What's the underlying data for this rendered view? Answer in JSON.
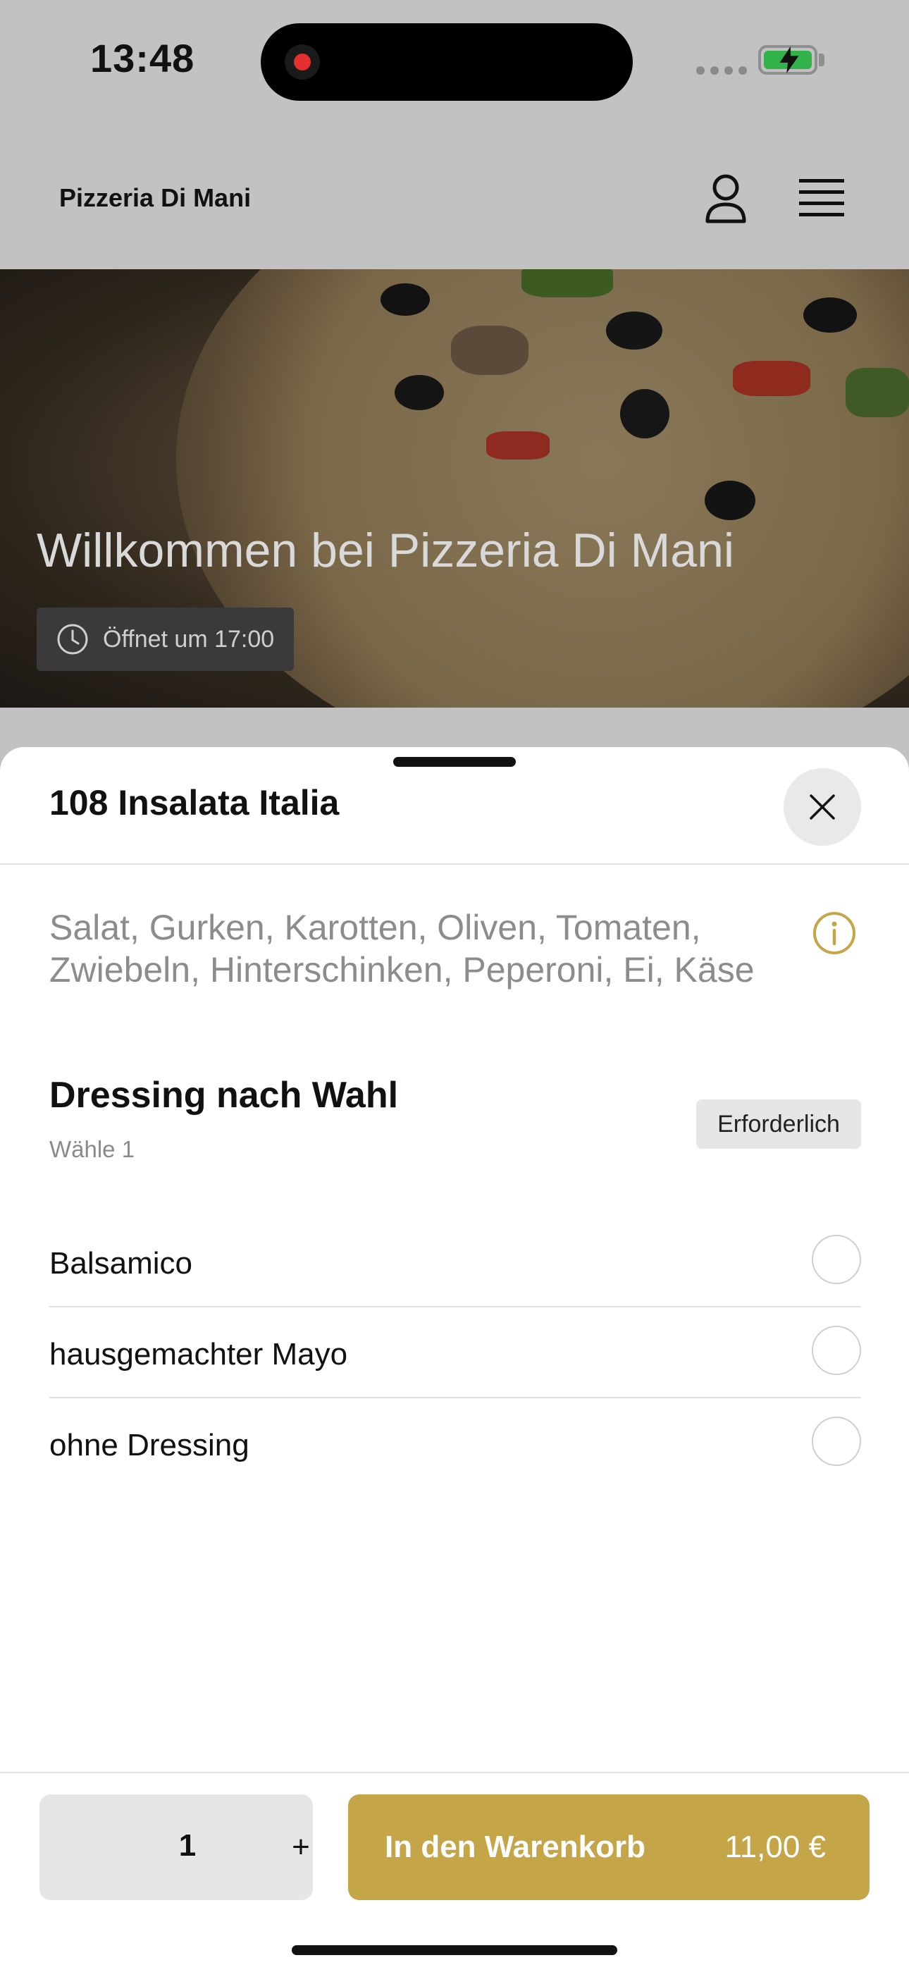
{
  "status_bar": {
    "time": "13:48"
  },
  "header": {
    "brand": "Pizzeria Di Mani",
    "account_icon": "user-icon",
    "menu_icon": "hamburger-menu-icon"
  },
  "hero": {
    "title": "Willkommen bei Pizzeria Di Mani",
    "hours": "Öffnet um 17:00",
    "hours_icon": "clock-icon"
  },
  "sheet": {
    "title": "108 Insalata Italia",
    "description": "Salat, Gurken, Karotten, Oliven, Tomaten, Zwiebeln, Hinterschinken, Peperoni, Ei, Käse",
    "info_icon": "info-icon",
    "option_group": {
      "title": "Dressing nach Wahl",
      "subtitle": "Wähle 1",
      "badge": "Erforderlich",
      "options": [
        {
          "label": "Balsamico",
          "selected": false
        },
        {
          "label": "hausgemachter Mayo",
          "selected": false
        },
        {
          "label": "ohne Dressing",
          "selected": false
        }
      ]
    }
  },
  "footer": {
    "quantity": "1",
    "plus_label": "+",
    "add_label": "In den Warenkorb",
    "price": "11,00 €"
  },
  "colors": {
    "accent": "#c4a548",
    "battery": "#31b24a",
    "record": "#e53030"
  }
}
